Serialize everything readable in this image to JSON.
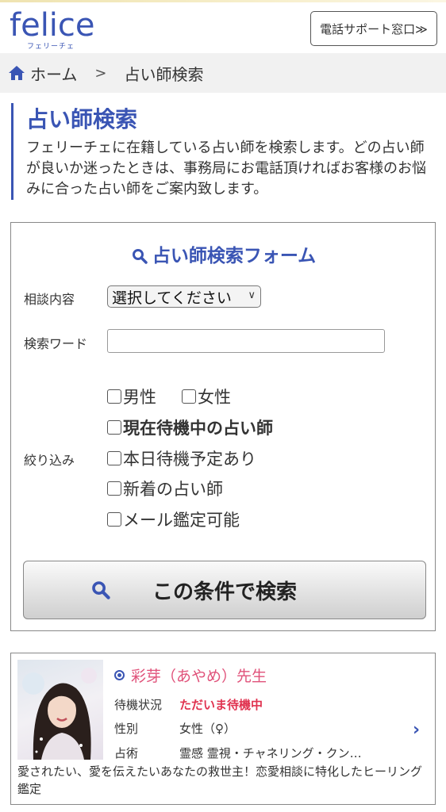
{
  "header": {
    "logo_text": "felice",
    "logo_sub": "フェリーチェ",
    "support_button": "電話サポート窓口≫"
  },
  "breadcrumb": {
    "home": "ホーム",
    "separator": ">",
    "current": "占い師検索"
  },
  "page": {
    "title": "占い師検索",
    "description": "フェリーチェに在籍している占い師を検索します。どの占い師が良いか迷ったときは、事務局にお電話頂ければお客様のお悩みに合った占い師をご案内致します。"
  },
  "search_form": {
    "title": "占い師検索フォーム",
    "consult_label": "相談内容",
    "consult_select_value": "選択してください",
    "keyword_label": "検索ワード",
    "keyword_value": "",
    "filter_label": "絞り込み",
    "filters": {
      "male": "男性",
      "female": "女性",
      "waiting_now": "現在待機中の占い師",
      "waiting_today": "本日待機予定あり",
      "new": "新着の占い師",
      "mail": "メール鑑定可能"
    },
    "submit": "この条件で検索"
  },
  "results": [
    {
      "name": "彩芽（あやめ）先生",
      "status_label": "待機状況",
      "status_value": "ただいま待機中",
      "gender_label": "性別",
      "gender_value": "女性（♀）",
      "method_label": "占術",
      "method_value": "霊感 霊視・チャネリング・クン…",
      "description": "愛されたい、愛を伝えたいあなたの救世主！恋愛相談に特化したヒーリング鑑定"
    }
  ],
  "colors": {
    "brand": "#3a55b4",
    "name_pink": "#e0527a",
    "status_red": "#e0324f",
    "breadcrumb_bg": "#f1f1f1"
  }
}
